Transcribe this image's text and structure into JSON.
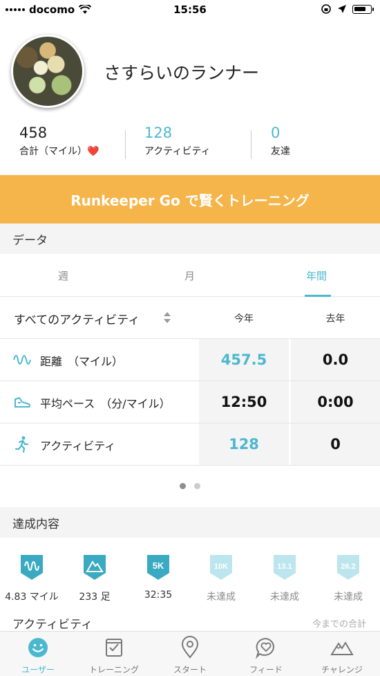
{
  "status_bar": {
    "carrier": "docomo",
    "time": "15:56"
  },
  "profile": {
    "name": "さすらいのランナー"
  },
  "stats": [
    {
      "value": "458",
      "label": "合計（マイル）❤️"
    },
    {
      "value": "128",
      "label": "アクティビティ"
    },
    {
      "value": "0",
      "label": "友達"
    }
  ],
  "banner": {
    "text": "Runkeeper Go で賢くトレーニング"
  },
  "data_section": {
    "title": "データ"
  },
  "tabs": [
    {
      "label": "週"
    },
    {
      "label": "月"
    },
    {
      "label": "年間"
    }
  ],
  "table": {
    "filter": "すべてのアクティビティ",
    "col_this_year": "今年",
    "col_last_year": "去年",
    "rows": [
      {
        "label": "距離　（マイル）",
        "this_year": "457.5",
        "last_year": "0.0"
      },
      {
        "label": "平均ペース　（分/マイル）",
        "this_year": "12:50",
        "last_year": "0:00"
      },
      {
        "label": "アクティビティ",
        "this_year": "128",
        "last_year": "0"
      }
    ]
  },
  "achievements": {
    "title": "達成内容",
    "items": [
      {
        "badge": "",
        "label": "4.83 マイル",
        "achieved": true
      },
      {
        "badge": "",
        "label": "233 足",
        "achieved": true
      },
      {
        "badge": "5K",
        "label": "32:35",
        "achieved": true
      },
      {
        "badge": "10K",
        "label": "未達成",
        "achieved": false
      },
      {
        "badge": "13.1",
        "label": "未達成",
        "achieved": false
      },
      {
        "badge": "26.2",
        "label": "未達成",
        "achieved": false
      }
    ]
  },
  "activity": {
    "title": "アクティビティ",
    "total_label": "今までの合計"
  },
  "nav": [
    {
      "label": "ユーザー"
    },
    {
      "label": "トレーニング"
    },
    {
      "label": "スタート"
    },
    {
      "label": "フィード"
    },
    {
      "label": "チャレンジ"
    }
  ],
  "colors": {
    "accent": "#4bb8d0",
    "banner": "#f5b54a"
  }
}
